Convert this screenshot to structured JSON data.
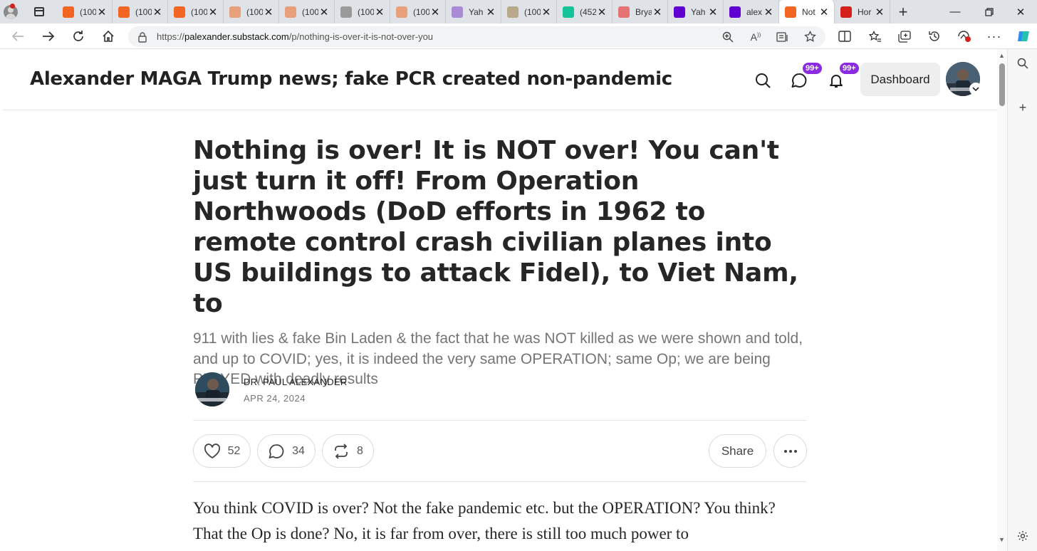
{
  "browser": {
    "tabs": [
      {
        "title": "(100",
        "favicon": "substack-icon",
        "color": "#f26522"
      },
      {
        "title": "(100",
        "favicon": "substack-icon",
        "color": "#f26522"
      },
      {
        "title": "(100",
        "favicon": "substack-icon",
        "color": "#f26522"
      },
      {
        "title": "(100",
        "favicon": "substack-icon",
        "color": "#e8a07a"
      },
      {
        "title": "(100",
        "favicon": "substack-icon",
        "color": "#e8a07a"
      },
      {
        "title": "(100",
        "favicon": "photo-icon",
        "color": "#9a9a9a"
      },
      {
        "title": "(100",
        "favicon": "substack-icon",
        "color": "#e8a07a"
      },
      {
        "title": "Yah",
        "favicon": "yahoo-icon",
        "color": "#a98ad6"
      },
      {
        "title": "(100",
        "favicon": "photo-icon",
        "color": "#b8a98a"
      },
      {
        "title": "(452",
        "favicon": "grammarly-icon",
        "color": "#15c39a"
      },
      {
        "title": "Brya",
        "favicon": "youtube-icon",
        "color": "#e57373"
      },
      {
        "title": "Yah",
        "favicon": "yahoo-icon",
        "color": "#6001d2"
      },
      {
        "title": "alex",
        "favicon": "yahoo-icon",
        "color": "#6001d2"
      },
      {
        "title": "Not",
        "favicon": "substack-icon",
        "color": "#f26522",
        "active": true
      },
      {
        "title": "Hor",
        "favicon": "shield-icon",
        "color": "#d4201a"
      }
    ],
    "url_prefix": "https://",
    "url_host": "palexander.substack.com",
    "url_path": "/p/nothing-is-over-it-is-not-over-you"
  },
  "publication": {
    "title": "Alexander MAGA Trump news; fake PCR created non-pandemic",
    "chat_badge": "99+",
    "notif_badge": "99+",
    "dashboard_label": "Dashboard"
  },
  "post": {
    "title": "Nothing is over! It is NOT over! You can't just turn it off! From Operation Northwoods (DoD efforts in 1962 to remote control crash civilian planes into US buildings to attack Fidel), to Viet Nam, to",
    "subtitle": "911 with lies & fake Bin Laden & the fact that he was NOT killed as we were shown and told, and up to COVID; yes, it is indeed the very same OPERATION; same Op; we are being PLAYED with deadly results",
    "author": "DR. PAUL ALEXANDER",
    "date": "APR 24, 2024",
    "likes": "52",
    "comments": "34",
    "restacks": "8",
    "share_label": "Share",
    "body": "You think COVID is over? Not the fake pandemic etc. but the OPERATION? You think? That the Op is done? No, it is far from over, there is still too much power to"
  }
}
